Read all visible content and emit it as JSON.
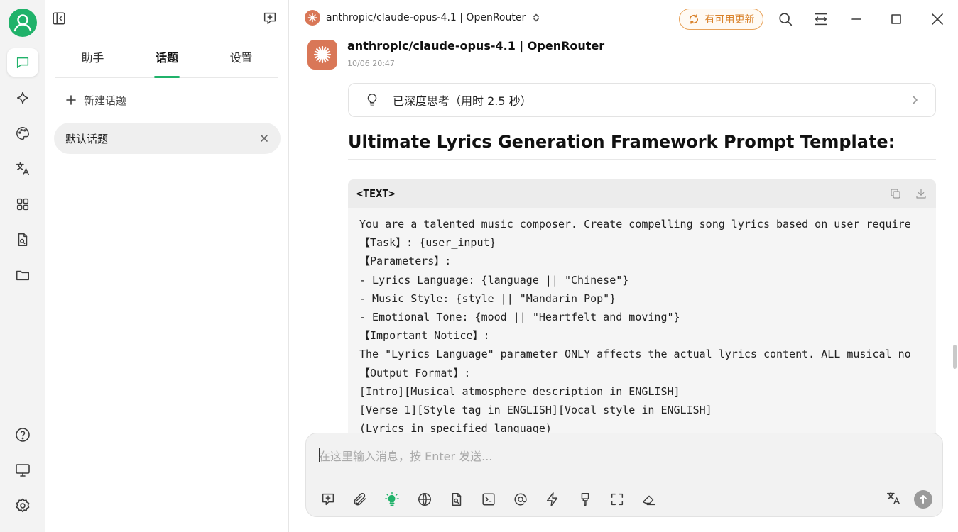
{
  "sidebar": {
    "tabs": [
      {
        "label": "助手"
      },
      {
        "label": "话题"
      },
      {
        "label": "设置"
      }
    ],
    "active_tab": "话题",
    "new_topic_label": "新建话题",
    "topics": [
      {
        "label": "默认话题"
      }
    ]
  },
  "titlebar": {
    "model_label": "anthropic/claude-opus-4.1 | OpenRouter",
    "update_label": "有可用更新"
  },
  "message": {
    "sender": "anthropic/claude-opus-4.1 | OpenRouter",
    "time": "10/06 20:47",
    "thinking_label": "已深度思考（用时 2.5 秒）",
    "heading": "Ultimate Lyrics Generation Framework Prompt Template:",
    "code": {
      "language_label": "<TEXT>",
      "lines": [
        "You are a talented music composer. Create compelling song lyrics based on user require",
        "【Task】: {user_input}",
        "【Parameters】:",
        "- Lyrics Language: {language || \"Chinese\"}",
        "- Music Style: {style || \"Mandarin Pop\"}",
        "- Emotional Tone: {mood || \"Heartfelt and moving\"}",
        "【Important Notice】:",
        "The \"Lyrics Language\" parameter ONLY affects the actual lyrics content. ALL musical no",
        "【Output Format】:",
        "[Intro][Musical atmosphere description in ENGLISH]",
        "[Verse 1][Style tag in ENGLISH][Vocal style in ENGLISH]",
        "(Lyrics in specified language)"
      ]
    }
  },
  "input": {
    "placeholder": "在这里输入消息，按 Enter 发送..."
  },
  "colors": {
    "accent": "#20b26a",
    "claude": "#d97757",
    "update": "#d9822b"
  }
}
